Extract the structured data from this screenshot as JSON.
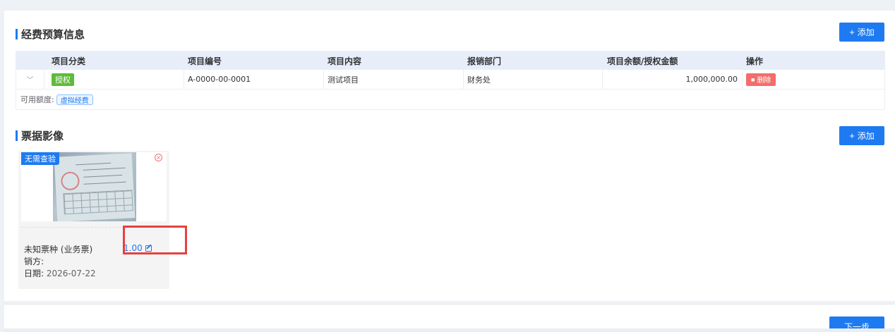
{
  "budget": {
    "title": "经费预算信息",
    "add_label": "添加",
    "columns": [
      "项目分类",
      "项目编号",
      "项目内容",
      "报销部门",
      "项目余额/授权金额",
      "操作"
    ],
    "rows": [
      {
        "category": "授权",
        "code": "A-0000-00-0001",
        "content": "测试项目",
        "department": "财务处",
        "amount": "1,000,000.00",
        "action": "删除"
      }
    ],
    "available_label": "可用额度:",
    "available_tag": "虚拟经费"
  },
  "invoice": {
    "title": "票据影像",
    "add_label": "添加",
    "cards": [
      {
        "badge": "无需查验",
        "type": "未知票种 (业务票)",
        "amount": "1.00",
        "seller_label": "销方:",
        "seller": "",
        "date_label": "日期:",
        "date": "2026-07-22"
      }
    ]
  },
  "footer": {
    "next_label": "下一步"
  },
  "colors": {
    "primary": "#1e7af0",
    "danger": "#f56c6c",
    "success": "#5dbb3a",
    "highlight": "#e8403e"
  }
}
